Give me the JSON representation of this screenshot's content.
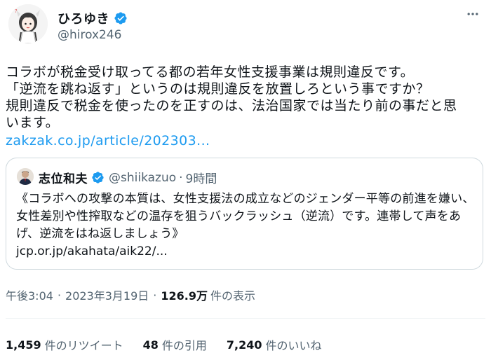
{
  "author": {
    "display_name": "ひろゆき",
    "handle": "@hirox246",
    "verified_icon": "verified-badge-icon"
  },
  "body": {
    "text": "コラボが税金受け取ってる都の若年女性支援事業は規則違反です。\n「逆流を跳ね返す」というのは規則違反を放置しろという事ですか？\n規則違反で税金を使ったのを正すのは、法治国家では当たり前の事だと思\nいます。",
    "link": "zakzak.co.jp/article/202303..."
  },
  "quote": {
    "display_name": "志位和夫",
    "handle": "@shiikazuo",
    "separator": "·",
    "time": "9時間",
    "text": "《コラボへの攻撃の本質は、女性支援法の成立などのジェンダー平等の前進を嫌い、女性差別や性搾取などの温存を狙うバックラッシュ（逆流）です。連帯して声をあげ、逆流をはね返しましょう》",
    "link": "jcp.or.jp/akahata/aik22/..."
  },
  "meta": {
    "time": "午後3:04",
    "separator": "·",
    "date": "2023年3月19日",
    "views_count": "126.9万",
    "views_label": "件の表示"
  },
  "stats": {
    "retweets_count": "1,459",
    "retweets_label": "件のリツイート",
    "quotes_count": "48",
    "quotes_label": "件の引用",
    "likes_count": "7,240",
    "likes_label": "件のいいね"
  },
  "colors": {
    "link": "#1d9bf0",
    "verified": "#1d9bf0",
    "secondary_text": "#536471",
    "border": "#cfd9de"
  }
}
